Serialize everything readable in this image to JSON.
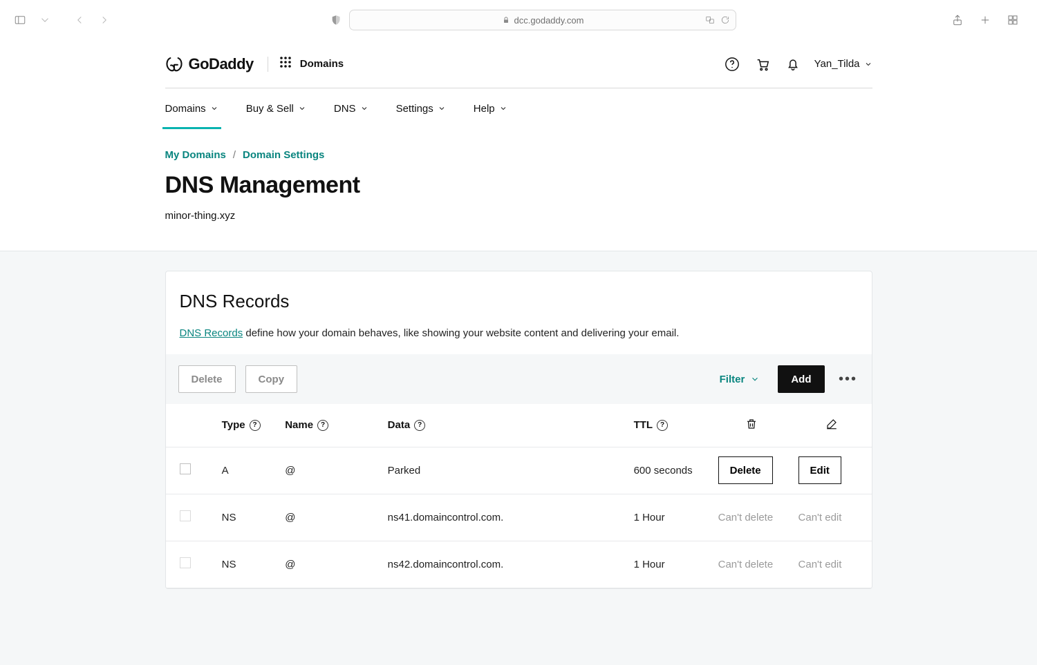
{
  "browser": {
    "url_host": "dcc.godaddy.com"
  },
  "header": {
    "brand": "GoDaddy",
    "apps_label": "Domains",
    "username": "Yan_Tilda"
  },
  "nav": {
    "items": [
      {
        "label": "Domains",
        "active": true
      },
      {
        "label": "Buy & Sell",
        "active": false
      },
      {
        "label": "DNS",
        "active": false
      },
      {
        "label": "Settings",
        "active": false
      },
      {
        "label": "Help",
        "active": false
      }
    ]
  },
  "breadcrumbs": {
    "items": [
      "My Domains",
      "Domain Settings"
    ]
  },
  "page": {
    "title": "DNS Management",
    "domain": "minor-thing.xyz"
  },
  "records_card": {
    "title": "DNS Records",
    "desc_link": "DNS Records",
    "desc_rest": " define how your domain behaves, like showing your website content and delivering your email.",
    "toolbar": {
      "delete": "Delete",
      "copy": "Copy",
      "filter": "Filter",
      "add": "Add"
    },
    "columns": {
      "type": "Type",
      "name": "Name",
      "data": "Data",
      "ttl": "TTL"
    },
    "row_labels": {
      "delete": "Delete",
      "edit": "Edit",
      "cant_delete": "Can't delete",
      "cant_edit": "Can't edit"
    },
    "rows": [
      {
        "type": "A",
        "name": "@",
        "data": "Parked",
        "ttl": "600 seconds",
        "locked": false
      },
      {
        "type": "NS",
        "name": "@",
        "data": "ns41.domaincontrol.com.",
        "ttl": "1 Hour",
        "locked": true
      },
      {
        "type": "NS",
        "name": "@",
        "data": "ns42.domaincontrol.com.",
        "ttl": "1 Hour",
        "locked": true
      }
    ]
  }
}
